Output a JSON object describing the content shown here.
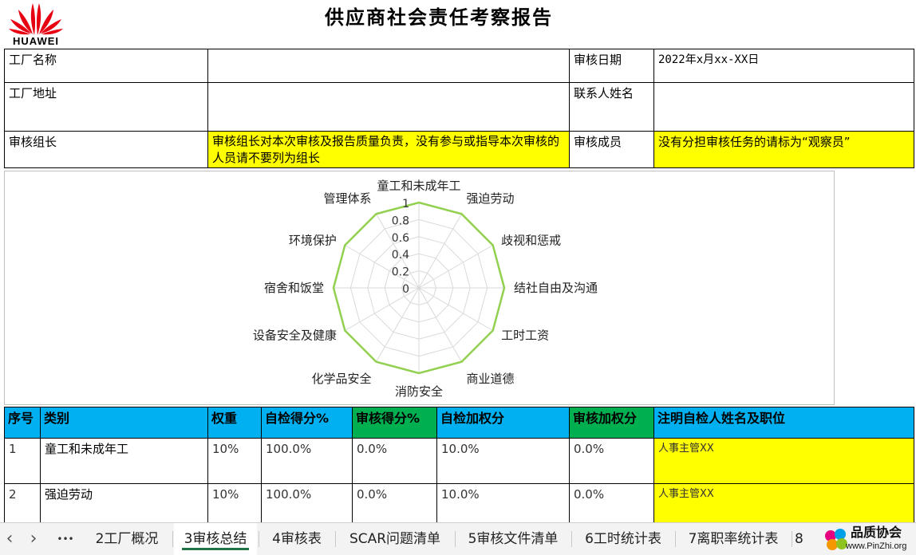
{
  "brand": {
    "name": "HUAWEI",
    "logo_color": "#e60012"
  },
  "report_title": "供应商社会责任考察报告",
  "info": {
    "factory_name_label": "工厂名称",
    "factory_name_value": "",
    "audit_date_label": "审核日期",
    "audit_date_value": "2022年x月xx-XX日",
    "factory_address_label": "工厂地址",
    "factory_address_value": "",
    "contact_label": "联系人姓名",
    "contact_value": "",
    "leader_label": "审核组长",
    "leader_note": "审核组长对本次审核及报告质量负责，没有参与或指导本次审核的人员请不要列为组长",
    "members_label": "审核成员",
    "members_note": "没有分担审核任务的请标为“观察员”"
  },
  "chart_data": {
    "type": "radar",
    "categories": [
      "童工和未成年工",
      "强迫劳动",
      "歧视和惩戒",
      "结社自由及沟通",
      "工时工资",
      "商业道德",
      "消防安全",
      "化学品安全",
      "设备安全及健康",
      "宿舍和饭堂",
      "环境保护",
      "管理体系"
    ],
    "series": [
      {
        "values": [
          1,
          1,
          1,
          1,
          1,
          1,
          1,
          1,
          1,
          1,
          1,
          1
        ],
        "color": "#92d050"
      }
    ],
    "ticks": [
      "0",
      "0.2",
      "0.4",
      "0.6",
      "0.8",
      "1"
    ],
    "rlim": [
      0,
      1
    ],
    "grid": true
  },
  "table": {
    "headers": [
      "序号",
      "类别",
      "权重",
      "自检得分%",
      "审核得分%",
      "自检加权分",
      "审核加权分",
      "注明自检人姓名及职位"
    ],
    "rows": [
      {
        "no": "1",
        "category": "童工和未成年工",
        "weight": "10%",
        "self_score": "100.0%",
        "audit_score": "0.0%",
        "self_weighted": "10.0%",
        "audit_weighted": "0.0%",
        "inspector": "人事主管XX"
      },
      {
        "no": "2",
        "category": "强迫劳动",
        "weight": "10%",
        "self_score": "100.0%",
        "audit_score": "0.0%",
        "self_weighted": "10.0%",
        "audit_weighted": "0.0%",
        "inspector": "人事主管XX"
      }
    ]
  },
  "tabs": {
    "prev_label": "‹",
    "next_label": "›",
    "more_label": "•••",
    "items": [
      "2工厂概况",
      "3审核总结",
      "4审核表",
      "SCAR问题清单",
      "5审核文件清单",
      "6工时统计表",
      "7离职率统计表",
      "8"
    ],
    "active_index": 1
  },
  "watermark": {
    "name": "品质协会",
    "url": "www.PinZhi.org"
  }
}
